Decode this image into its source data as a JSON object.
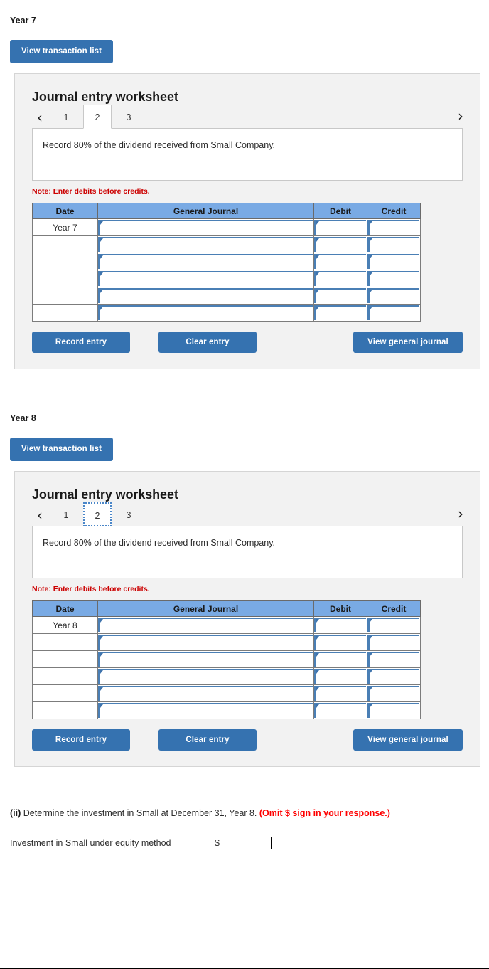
{
  "sections": [
    {
      "year_label": "Year 7",
      "view_transaction_list": "View transaction list",
      "worksheet_title": "Journal entry worksheet",
      "prev_chevron": "‹",
      "next_chevron": "›",
      "tabs": [
        {
          "label": "1",
          "active": false
        },
        {
          "label": "2",
          "active": true
        },
        {
          "label": "3",
          "active": false
        }
      ],
      "active_tab_focused": false,
      "description": "Record 80% of the dividend received from Small Company.",
      "note": "Note: Enter debits before credits.",
      "table": {
        "headers": [
          "Date",
          "General Journal",
          "Debit",
          "Credit"
        ],
        "rows": [
          {
            "date": "Year 7",
            "general_journal": "",
            "debit": "",
            "credit": ""
          },
          {
            "date": "",
            "general_journal": "",
            "debit": "",
            "credit": ""
          },
          {
            "date": "",
            "general_journal": "",
            "debit": "",
            "credit": ""
          },
          {
            "date": "",
            "general_journal": "",
            "debit": "",
            "credit": ""
          },
          {
            "date": "",
            "general_journal": "",
            "debit": "",
            "credit": ""
          },
          {
            "date": "",
            "general_journal": "",
            "debit": "",
            "credit": ""
          }
        ]
      },
      "buttons": {
        "record_entry": "Record entry",
        "clear_entry": "Clear entry",
        "view_general_journal": "View general journal"
      }
    },
    {
      "year_label": "Year 8",
      "view_transaction_list": "View transaction list",
      "worksheet_title": "Journal entry worksheet",
      "prev_chevron": "‹",
      "next_chevron": "›",
      "tabs": [
        {
          "label": "1",
          "active": false
        },
        {
          "label": "2",
          "active": true
        },
        {
          "label": "3",
          "active": false
        }
      ],
      "active_tab_focused": true,
      "description": "Record 80% of the dividend received from Small Company.",
      "note": "Note: Enter debits before credits.",
      "table": {
        "headers": [
          "Date",
          "General Journal",
          "Debit",
          "Credit"
        ],
        "rows": [
          {
            "date": "Year 8",
            "general_journal": "",
            "debit": "",
            "credit": ""
          },
          {
            "date": "",
            "general_journal": "",
            "debit": "",
            "credit": ""
          },
          {
            "date": "",
            "general_journal": "",
            "debit": "",
            "credit": ""
          },
          {
            "date": "",
            "general_journal": "",
            "debit": "",
            "credit": ""
          },
          {
            "date": "",
            "general_journal": "",
            "debit": "",
            "credit": ""
          },
          {
            "date": "",
            "general_journal": "",
            "debit": "",
            "credit": ""
          }
        ]
      },
      "buttons": {
        "record_entry": "Record entry",
        "clear_entry": "Clear entry",
        "view_general_journal": "View general journal"
      }
    }
  ],
  "question": {
    "marker": "(ii)",
    "text": " Determine the investment in Small at December 31, Year 8. ",
    "omit_note": "(Omit $ sign in your response.)",
    "answer_label": "Investment in Small under equity method",
    "currency_symbol": "$",
    "answer_value": "",
    "answer_placeholder": ""
  },
  "colors": {
    "button_blue": "#3572b0",
    "table_header_blue": "#79aae4",
    "note_red": "#cc0000",
    "omit_red": "#ff0000",
    "panel_gray": "#f2f2f2",
    "field_border_blue": "#4a7fb5"
  }
}
